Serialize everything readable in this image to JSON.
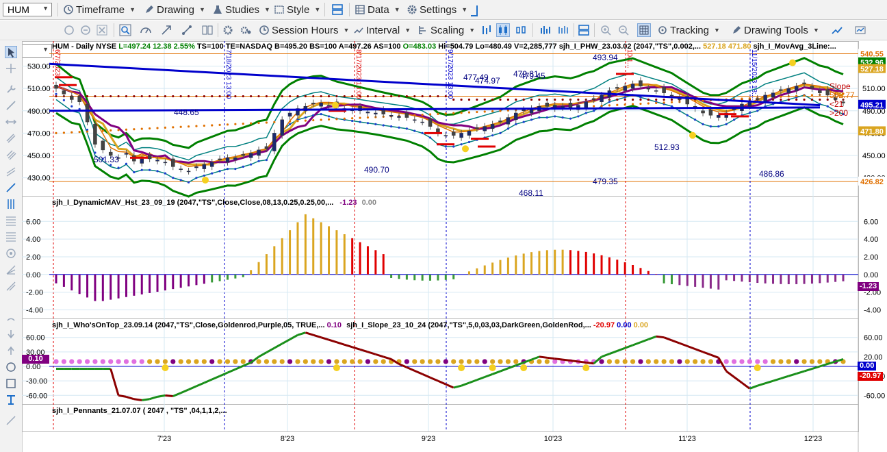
{
  "toolbar1": {
    "symbol": "HUM",
    "timeframe": "Timeframe",
    "drawing": "Drawing",
    "studies": "Studies",
    "style": "Style",
    "data": "Data",
    "settings": "Settings"
  },
  "toolbar2": {
    "session_hours": "Session Hours",
    "interval": "Interval",
    "scaling": "Scaling",
    "tracking": "Tracking",
    "drawing_tools": "Drawing Tools"
  },
  "header": {
    "symbol_line": "HUM - Daily  NYSE",
    "L": "L=497.24",
    "chg": "12.38",
    "pct": "2.55%",
    "meta": "TS=100  TE=NASDAQ  B=495.20  BS=100  A=497.26  AS=100",
    "O": "O=483.03",
    "ohlv": "Hi=504.79  Lo=480.49  V=2,285,777",
    "phw": "sjh_I_PHW_23.03.02 (2047,\"TS\",0.002,...",
    "phw_v1": "527.18",
    "phw_v2": "471.80",
    "movavg": "sjh_I_MovAvg_3Line:..."
  },
  "colors": {
    "green": "#008000",
    "blue": "#0000cc",
    "red": "#e00000",
    "gold": "#daa520",
    "purple": "#800080",
    "dkred": "#8b0000",
    "teal": "#008080",
    "orange": "#e07000"
  },
  "price_pane": {
    "y_ticks": [
      "530.00",
      "510.00",
      "490.00",
      "470.00",
      "450.00",
      "430.00"
    ],
    "badges": [
      {
        "text": "540.55",
        "bg": "#ffffff",
        "fg": "#e07000",
        "v": 541
      },
      {
        "text": "532.96",
        "bg": "#008000",
        "fg": "#ffffff",
        "v": 533.5
      },
      {
        "text": "527.18",
        "bg": "#daa520",
        "fg": "#ffffff",
        "v": 527.5
      },
      {
        "text": "495.21",
        "bg": "#0000cc",
        "fg": "#ffffff",
        "v": 495.5
      },
      {
        "text": "471.80",
        "bg": "#daa520",
        "fg": "#ffffff",
        "v": 471.8
      },
      {
        "text": "426.82",
        "bg": "#ffffff",
        "fg": "#e07000",
        "v": 426.8
      }
    ],
    "labels": [
      {
        "text": "501.33",
        "x": 105,
        "y": 237
      },
      {
        "text": "448.65",
        "x": 222,
        "y": 168
      },
      {
        "text": "490.70",
        "x": 500,
        "y": 252
      },
      {
        "text": "477.49",
        "x": 645,
        "y": 117
      },
      {
        "text": "474.97",
        "x": 662,
        "y": 122
      },
      {
        "text": "479.81",
        "x": 718,
        "y": 112
      },
      {
        "text": "479.45",
        "x": 728,
        "y": 115
      },
      {
        "text": "468.11",
        "x": 726,
        "y": 286
      },
      {
        "text": "493.94",
        "x": 834,
        "y": 88
      },
      {
        "text": "479.35",
        "x": 834,
        "y": 269
      },
      {
        "text": "512.93",
        "x": 924,
        "y": 219
      },
      {
        "text": "486.86",
        "x": 1077,
        "y": 258
      }
    ],
    "right_labels": [
      "Slope",
      "502.77",
      "<21",
      ">200"
    ]
  },
  "hist_pane": {
    "title": "sjh_I_DynamicMAV_Hst_23_09_19 (2047,\"TS\",Close,Close,08,13,0.25,0.25,00,...",
    "v1": "-1.23",
    "v2": "0.00",
    "y_ticks": [
      "6.00",
      "4.00",
      "2.00",
      "0.00",
      "-2.00",
      "-4.00"
    ],
    "badge": "-1.23"
  },
  "osc_pane": {
    "title1": "sjh_I_Who'sOnTop_23.09.14 (2047,\"TS\",Close,Goldenrod,Purple,05,  TRUE,...",
    "t1v": "0.10",
    "title2": "sjh_I_Slope_23_10_24 (2047,\"TS\",5,0,03,03,DarkGreen,GoldenRod,...",
    "t2v1": "-20.97",
    "t2v2": "0.00",
    "t2v3": "0.00",
    "y_ticks": [
      "60.00",
      "30.00",
      "0.00",
      "-30.00",
      "-60.00"
    ],
    "left_badge": "0.10",
    "right_ticks": [
      "60.00",
      "20.00",
      "-20.00",
      "-60.00"
    ],
    "badge_blue": "0.00",
    "badge_red": "-20.97"
  },
  "pennants_pane": {
    "title": "sjh_I_Pennants_21.07.07 (  2047 ,  \"TS\" ,04,1,1,2,..."
  },
  "x_axis": [
    "7'23",
    "8'23",
    "9'23",
    "10'23",
    "11'23",
    "12'23"
  ],
  "vline_labels": [
    "6/7/2023",
    "7/18/2023 13:00",
    "8/17/2023 13:00",
    "9/17/2023 13:00",
    "10/1...",
    "11/15/2023 13:..."
  ],
  "chart_data": {
    "type": "candlestick",
    "title": "HUM - Daily NYSE",
    "ylim": [
      420,
      545
    ],
    "series": [
      {
        "name": "Close",
        "values": [
          510,
          505,
          500,
          498,
          480,
          460,
          455,
          450,
          448,
          452,
          445,
          447,
          447,
          446,
          444,
          440,
          438,
          436,
          440,
          442,
          444,
          446,
          448,
          448,
          450,
          452,
          455,
          456,
          470,
          482,
          488,
          492,
          494,
          496,
          497,
          495,
          493,
          492,
          491,
          490,
          489,
          488,
          487,
          486,
          485,
          484,
          482,
          480,
          476,
          470,
          468,
          468,
          470,
          472,
          474,
          476,
          478,
          480,
          484,
          488,
          490,
          492,
          494,
          494,
          495,
          494,
          493,
          495,
          498,
          500,
          504,
          508,
          510,
          512,
          514,
          512,
          510,
          508,
          506,
          504,
          500,
          496,
          492,
          488,
          486,
          486,
          488,
          492,
          496,
          498,
          500,
          504,
          506,
          508,
          510,
          512,
          514,
          510,
          506,
          504,
          500,
          497
        ]
      }
    ]
  }
}
